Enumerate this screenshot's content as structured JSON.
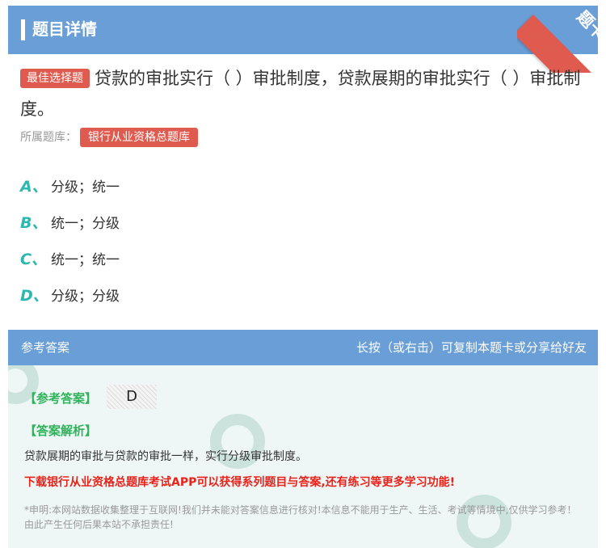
{
  "header": {
    "title": "题目详情"
  },
  "ribbon": {
    "label": "题卡"
  },
  "question": {
    "tag": "最佳选择题",
    "text": "贷款的审批实行（    ）审批制度，贷款展期的审批实行（    ）审批制度。",
    "bank_label": "所属题库：",
    "bank_name": "银行从业资格总题库"
  },
  "options": [
    {
      "letter": "A、",
      "text": "分级；统一"
    },
    {
      "letter": "B、",
      "text": "统一；分级"
    },
    {
      "letter": "C、",
      "text": "统一；统一"
    },
    {
      "letter": "D、",
      "text": "分级；分级"
    }
  ],
  "answer_section": {
    "title": "参考答案",
    "hint": "长按（或右击）可复制本题卡或分享给好友",
    "answer_label": "【参考答案】",
    "answer_value": "D",
    "analysis_label": "【答案解析】",
    "analysis_text": "贷款展期的审批与贷款的审批一样，实行分级审批制度。",
    "promo": "下载银行从业资格总题库考试APP可以获得系列题目与答案,还有练习等更多学习功能!",
    "disclaimer": "*申明:本网站数据收集整理于互联网!我们并未能对答案信息进行核对!本信息不能用于生产、生活、考试等情境中,仅供学习参考！由此产生任何后果本站不承担责任!"
  },
  "colors": {
    "header_bg": "#6a9ed6",
    "accent_red": "#e05b4f",
    "option_letter": "#2cb7b0",
    "answer_green": "#2fb35a",
    "promo_red": "#e8231b"
  }
}
